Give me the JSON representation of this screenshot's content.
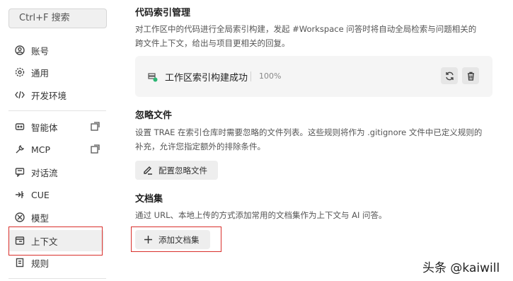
{
  "sidebar": {
    "search_label": "Ctrl+F 搜索",
    "items": [
      {
        "label": "账号",
        "icon": "user-icon"
      },
      {
        "label": "通用",
        "icon": "gear-icon"
      },
      {
        "label": "开发环境",
        "icon": "code-icon"
      },
      {
        "label": "智能体",
        "icon": "agent-icon",
        "external": true
      },
      {
        "label": "MCP",
        "icon": "wrench-icon",
        "external": true
      },
      {
        "label": "对话流",
        "icon": "chat-icon"
      },
      {
        "label": "CUE",
        "icon": "cue-icon"
      },
      {
        "label": "模型",
        "icon": "model-icon"
      },
      {
        "label": "上下文",
        "icon": "context-icon",
        "active": true
      },
      {
        "label": "规则",
        "icon": "rules-icon"
      }
    ]
  },
  "main": {
    "index": {
      "title": "代码索引管理",
      "desc_line1": "对工作区中的代码进行全局索引构建，发起 #Workspace 问答时将自动全局检索与问题相关的",
      "desc_line2": "跨文件上下文，给出与项目更相关的回复。",
      "status": "工作区索引构建成功",
      "progress": "100%",
      "progress_value": 1.0
    },
    "ignore": {
      "title": "忽略文件",
      "desc_line1": "设置 TRAE 在索引仓库时需要忽略的文件列表。这些规则将作为 .gitignore 文件中已定义规则的",
      "desc_line2": "补充，允许您指定额外的排除条件。",
      "button": "配置忽略文件"
    },
    "docs": {
      "title": "文档集",
      "desc": "通过 URL、本地上传的方式添加常用的文档集作为上下文与 AI 问答。",
      "button": "添加文档集"
    }
  },
  "watermark": "头条 @kaiwill",
  "colors": {
    "highlight_box": "#d9302c",
    "success": "#2bb673"
  }
}
